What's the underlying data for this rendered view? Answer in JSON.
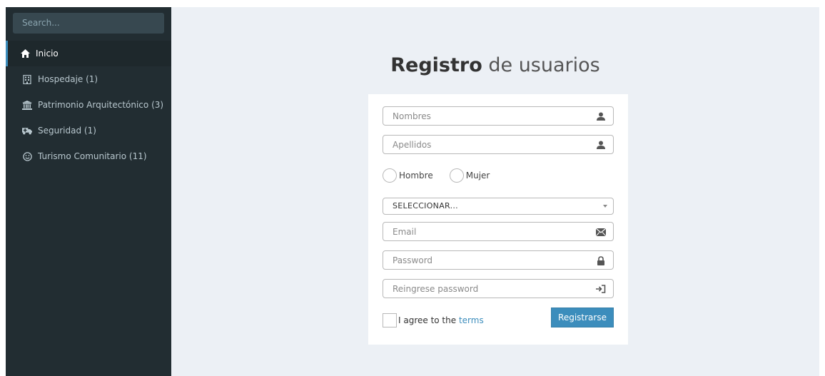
{
  "sidebar": {
    "search_placeholder": "Search...",
    "items": [
      {
        "label": "Inicio",
        "icon": "home-icon",
        "active": true
      },
      {
        "label": "Hospedaje (1)",
        "icon": "building-icon"
      },
      {
        "label": "Patrimonio Arquitectónico (3)",
        "icon": "institution-icon"
      },
      {
        "label": "Seguridad (1)",
        "icon": "ambulance-icon"
      },
      {
        "label": "Turismo Comunitario (11)",
        "icon": "smile-icon"
      }
    ]
  },
  "form": {
    "title_bold": "Registro",
    "title_rest": " de usuarios",
    "nombres_placeholder": "Nombres",
    "apellidos_placeholder": "Apellidos",
    "gender_options": [
      "Hombre",
      "Mujer"
    ],
    "select_value": "SELECCIONAR...",
    "email_placeholder": "Email",
    "password_placeholder": "Password",
    "repassword_placeholder": "Reingrese password",
    "agree_text": "I agree to the ",
    "terms_link": "terms",
    "submit_label": "Registrarse"
  },
  "colors": {
    "sidebar_bg": "#222d32",
    "content_bg": "#ecf0f5",
    "accent": "#3c8dbc"
  }
}
